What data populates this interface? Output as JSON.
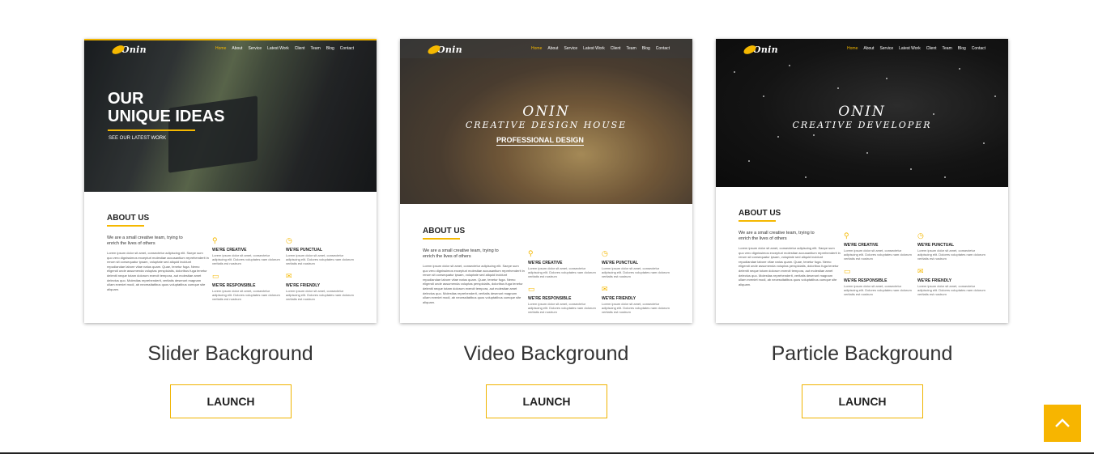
{
  "colors": {
    "accent": "#f5b800",
    "button_border": "#f0b400",
    "to_top_bg": "#f7b500"
  },
  "demos": [
    {
      "title": "Slider Background",
      "launch_label": "LAUNCH",
      "preview": {
        "logo": "Onin",
        "nav": [
          "Home",
          "About",
          "Service",
          "Latest Work",
          "Client",
          "Team",
          "Blog",
          "Contact"
        ],
        "hero_heading_line1": "OUR",
        "hero_heading_line2": "UNIQUE IDEAS",
        "hero_sub": "SEE OUR LATEST WORK",
        "about_title": "ABOUT US",
        "about_intro": "We are a small creative team, trying to enrich the lives of others",
        "about_body": "Lorem ipsum dolor sit amet, consectetur adipiscing elit. Saepe sum quo vero dignissimos excepturi molestiae accusantium reprehenderit in rerum sit consequatur ipsam, voluptate sed aliquid incidunt repudiandae labore vitae natus quam. Quae, tenetur fuga. Nemo eligendi unde assumenda voluptas perspiciatis, doloribus fuga tenetur deleniti neque totam dolorum exercit tempora, aut molestiae amet delectus quo. Molestias reprehenderit, veritatis deserunt magnam ullam eveniet modi, ab necessitatibus quos voluptatibus cumque site aliquam.",
        "features": [
          {
            "icon": "network-icon",
            "glyph": "⚲",
            "title": "WE'RE CREATIVE",
            "text": "Lorem ipsum dolor sit amet, consectetur adipiscing elit. Dolores voluptates nam dolorum veritatis est nostrum"
          },
          {
            "icon": "clock-icon",
            "glyph": "◷",
            "title": "WE'RE PUNCTUAL",
            "text": "Lorem ipsum dolor sit amet, consectetur adipiscing elit. Dolores voluptates nam dolorum veritatis est nostrum"
          },
          {
            "icon": "monitor-icon",
            "glyph": "▭",
            "title": "WE'RE RESPONSIBLE",
            "text": "Lorem ipsum dolor sit amet, consectetur adipiscing elit. Dolores voluptates nam dolorum veritatis est nostrum"
          },
          {
            "icon": "chat-icon",
            "glyph": "✉",
            "title": "WE'RE FRIENDLY",
            "text": "Lorem ipsum dolor sit amet, consectetur adipiscing elit. Dolores voluptates nam dolorum veritatis est nostrum"
          }
        ]
      }
    },
    {
      "title": "Video Background",
      "launch_label": "LAUNCH",
      "preview": {
        "logo": "Onin",
        "nav": [
          "Home",
          "About",
          "Service",
          "Latest Work",
          "Client",
          "Team",
          "Blog",
          "Contact"
        ],
        "hero_title": "ONIN",
        "hero_sub": "CREATIVE DESIGN HOUSE",
        "hero_button": "PROFESSIONAL DESIGN",
        "about_title": "ABOUT US",
        "about_intro": "We are a small creative team, trying to enrich the lives of others",
        "about_body": "Lorem ipsum dolor sit amet, consectetur adipiscing elit. Saepe sum quo vero dignissimos excepturi molestiae accusantium reprehenderit in rerum sit consequatur ipsam, voluptate sed aliquid incidunt repudiandae labore vitae natus quam. Quae, tenetur fuga. Nemo eligendi unde assumenda voluptas perspiciatis, doloribus fuga tenetur deleniti neque totam dolorum exercit tempora, aut molestiae amet delectus quo. Molestias reprehenderit, veritatis deserunt magnam ullam eveniet modi, ab necessitatibus quos voluptatibus cumque site aliquam.",
        "features": [
          {
            "icon": "network-icon",
            "glyph": "⚲",
            "title": "WE'RE CREATIVE",
            "text": "Lorem ipsum dolor sit amet, consectetur adipiscing elit. Dolores voluptates nam dolorum veritatis est nostrum"
          },
          {
            "icon": "clock-icon",
            "glyph": "◷",
            "title": "WE'RE PUNCTUAL",
            "text": "Lorem ipsum dolor sit amet, consectetur adipiscing elit. Dolores voluptates nam dolorum veritatis est nostrum"
          },
          {
            "icon": "monitor-icon",
            "glyph": "▭",
            "title": "WE'RE RESPONSIBLE",
            "text": "Lorem ipsum dolor sit amet, consectetur adipiscing elit. Dolores voluptates nam dolorum veritatis est nostrum"
          },
          {
            "icon": "chat-icon",
            "glyph": "✉",
            "title": "WE'RE FRIENDLY",
            "text": "Lorem ipsum dolor sit amet, consectetur adipiscing elit. Dolores voluptates nam dolorum veritatis est nostrum"
          }
        ]
      }
    },
    {
      "title": "Particle Background",
      "launch_label": "LAUNCH",
      "preview": {
        "logo": "Onin",
        "nav": [
          "Home",
          "About",
          "Service",
          "Latest Work",
          "Client",
          "Team",
          "Blog",
          "Contact"
        ],
        "hero_title": "ONIN",
        "hero_sub": "CREATIVE DEVELOPER",
        "about_title": "ABOUT US",
        "about_intro": "We are a small creative team, trying to enrich the lives of others",
        "about_body": "Lorem ipsum dolor sit amet, consectetur adipiscing elit. Saepe sum quo vero dignissimos excepturi molestiae accusantium reprehenderit in rerum sit consequatur ipsam, voluptate sed aliquid incidunt repudiandae labore vitae natus quam. Quae, tenetur fuga. Nemo eligendi unde assumenda voluptas perspiciatis, doloribus fuga tenetur deleniti neque totam dolorum exercit tempora, aut molestiae amet delectus quo. Molestias reprehenderit, veritatis deserunt magnam ullam eveniet modi, ab necessitatibus quos voluptatibus cumque site aliquam.",
        "features": [
          {
            "icon": "network-icon",
            "glyph": "⚲",
            "title": "WE'RE CREATIVE",
            "text": "Lorem ipsum dolor sit amet, consectetur adipiscing elit. Dolores voluptates nam dolorum veritatis est nostrum"
          },
          {
            "icon": "clock-icon",
            "glyph": "◷",
            "title": "WE'RE PUNCTUAL",
            "text": "Lorem ipsum dolor sit amet, consectetur adipiscing elit. Dolores voluptates nam dolorum veritatis est nostrum"
          },
          {
            "icon": "monitor-icon",
            "glyph": "▭",
            "title": "WE'RE RESPONSIBLE",
            "text": "Lorem ipsum dolor sit amet, consectetur adipiscing elit. Dolores voluptates nam dolorum veritatis est nostrum"
          },
          {
            "icon": "chat-icon",
            "glyph": "✉",
            "title": "WE'RE FRIENDLY",
            "text": "Lorem ipsum dolor sit amet, consectetur adipiscing elit. Dolores voluptates nam dolorum veritatis est nostrum"
          }
        ]
      }
    }
  ],
  "back_to_top": {
    "icon": "chevron-up-icon"
  }
}
